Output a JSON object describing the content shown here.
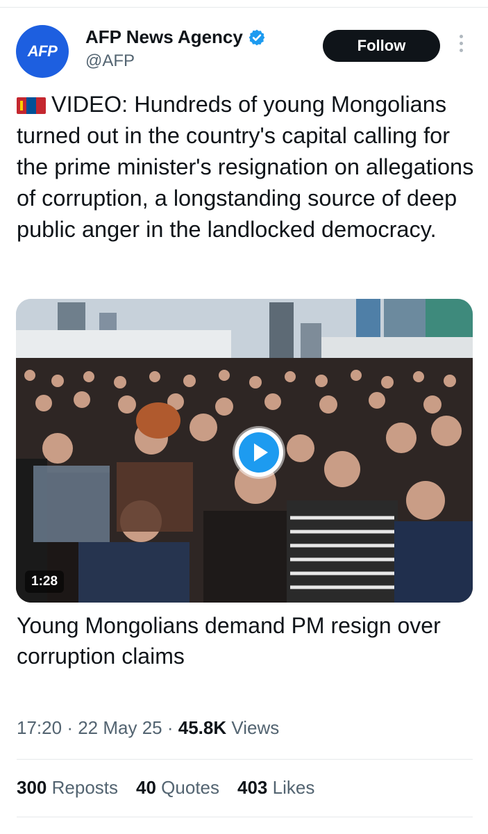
{
  "account": {
    "avatar_text": "AFP",
    "display_name": "AFP News Agency",
    "handle": "@AFP",
    "follow_label": "Follow"
  },
  "tweet": {
    "flag_icon": "mongolia-flag-icon",
    "text": "VIDEO: Hundreds of young Mongolians turned out in the country's capital calling for the prime minister's resignation on allegations of corruption, a longstanding source of deep public anger in the landlocked democracy.",
    "media": {
      "duration": "1:28",
      "caption": "Young Mongolians demand PM resign over corruption claims"
    },
    "time": "17:20",
    "date": "22 May 25",
    "views_count": "45.8K",
    "views_label": "Views",
    "separator": "·",
    "reposts_count": "300",
    "reposts_label": "Reposts",
    "quotes_count": "40",
    "quotes_label": "Quotes",
    "likes_count": "403",
    "likes_label": "Likes"
  },
  "colors": {
    "accent": "#1d9bf0",
    "follow_bg": "#0f1419",
    "avatar_bg": "#1d5fe0",
    "muted_text": "#536471"
  }
}
